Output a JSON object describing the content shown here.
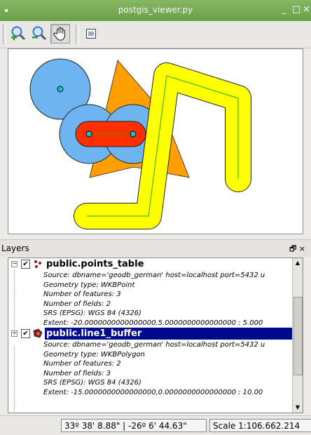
{
  "window": {
    "title": "postgis_viewer.py",
    "minimize": "_",
    "maximize": "□",
    "close": "×"
  },
  "toolbar": {
    "buttons": [
      {
        "name": "zoom-in",
        "icon": "zoom-in-icon"
      },
      {
        "name": "zoom-out",
        "icon": "zoom-out-icon"
      },
      {
        "name": "pan",
        "icon": "pan-hand-icon",
        "active": true
      },
      {
        "name": "extent",
        "icon": "zoom-extent-icon"
      }
    ]
  },
  "map": {
    "colors": {
      "buffer_fill": "#ffff00",
      "line": "#22aa22",
      "circle_fill": "#6eb4f0",
      "triangle_fill": "#ff9f00",
      "polygon_fill": "#ff2f00",
      "point_fill": "#00c8c8"
    }
  },
  "layers_panel": {
    "title": "Layers",
    "layers": [
      {
        "name": "public.points_table",
        "checked": true,
        "selected": false,
        "info": [
          "Source: dbname='geodb_german' host=localhost port=5432 u",
          "Geometry type: WKBPoint",
          "Number of features: 3",
          "Number of fields: 2",
          "SRS (EPSG): WGS 84 (4326)",
          "Extent: -20.0000000000000000,5.0000000000000000 : 5.000"
        ]
      },
      {
        "name": "public.line1_buffer",
        "checked": true,
        "selected": true,
        "info": [
          "Source: dbname='geodb_german' host=localhost port=5432 u",
          "Geometry type: WKBPolygon",
          "Number of features: 2",
          "Number of fields: 3",
          "SRS (EPSG): WGS 84 (4326)",
          "Extent: -15.0000000000000000,0.0000000000000000 : 10.00"
        ]
      }
    ]
  },
  "status": {
    "coordinates": "33º 38' 8.88\" | -26º 6' 44.63\"",
    "scale": "Scale 1:106.662.214"
  }
}
